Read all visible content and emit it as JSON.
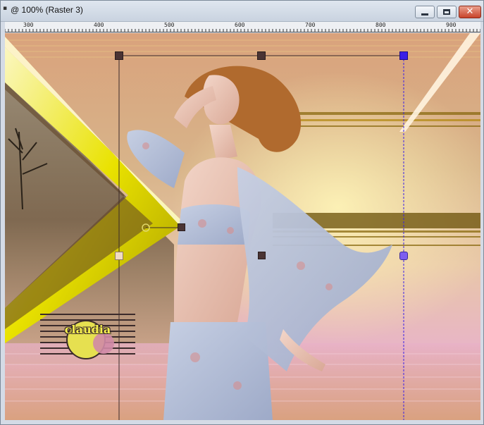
{
  "window": {
    "title": "@ 100% (Raster 3)",
    "icon": "image-doc-icon",
    "close_symbol": "✕"
  },
  "ruler": {
    "labels": [
      "300",
      "400",
      "500",
      "600",
      "700",
      "800",
      "900"
    ]
  },
  "canvas": {
    "logo_text": "claudia"
  },
  "colors": {
    "titlebar": "#d4dbe6",
    "close_button": "#c8432b",
    "selection_handle": "#4a3434",
    "handle_highlight": "#3a1fe6"
  }
}
